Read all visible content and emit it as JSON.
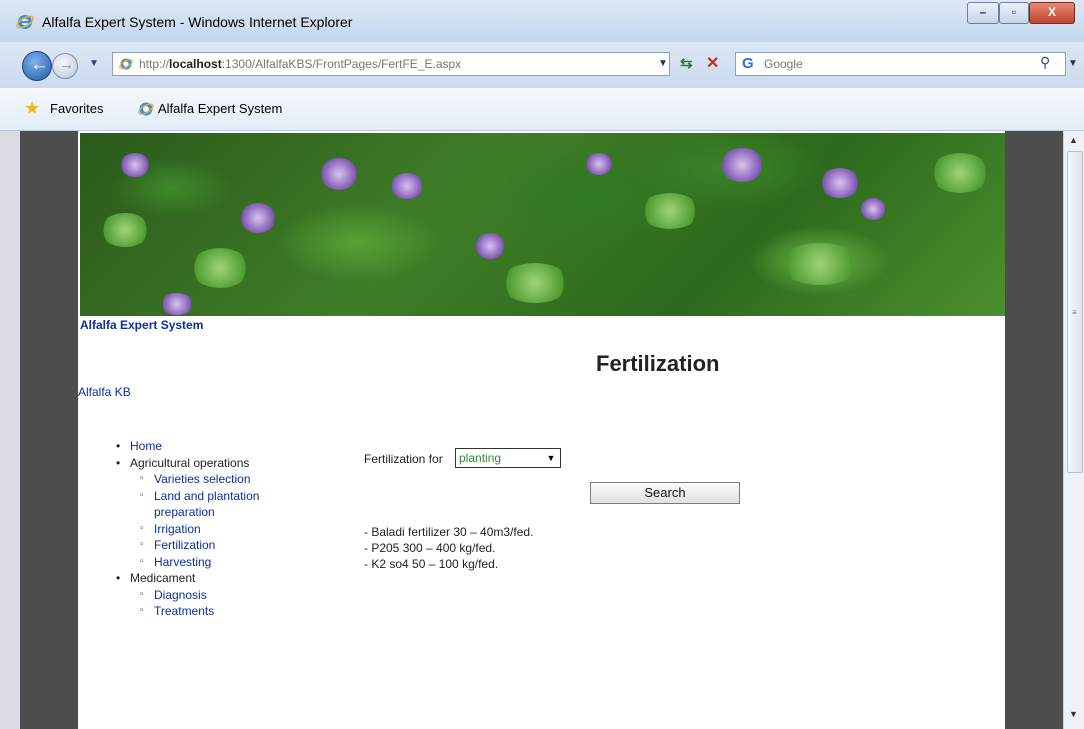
{
  "window": {
    "title": "Alfalfa Expert System - Windows Internet Explorer",
    "minimize_glyph": "–",
    "maximize_glyph": "▫",
    "close_glyph": "X"
  },
  "addressbar": {
    "url_prefix": "http://",
    "url_host": "localhost",
    "url_rest": ":1300/AlfalfaKBS/FrontPages/FertFE_E.aspx",
    "search_placeholder": "Google"
  },
  "favorites_bar": {
    "favorites_label": "Favorites",
    "tab_label": "Alfalfa Expert System"
  },
  "page": {
    "site_title": "Alfalfa Expert System",
    "heading": "Fertilization",
    "kb_link": "Alfalfa KB",
    "menu": {
      "home": "Home",
      "agri_ops": "Agricultural operations",
      "varieties": "Varieties selection",
      "land_prep_line1": "Land and plantation",
      "land_prep_line2": "preparation",
      "irrigation": "Irrigation",
      "fertilization": "Fertilization",
      "harvesting": "Harvesting",
      "medicament": "Medicament",
      "diagnosis": "Diagnosis",
      "treatments": "Treatments"
    },
    "form": {
      "label": "Fertilization for",
      "selected_value": "planting",
      "search_button": "Search"
    },
    "results": [
      "- Baladi fertilizer 30 – 40m3/fed.",
      "- P205 300 – 400 kg/fed.",
      "- K2 so4 50 – 100 kg/fed."
    ]
  },
  "colors": {
    "link_blue": "#0b2f9e",
    "gutter": "#4d4d4d",
    "select_text": "#2f8b2f"
  }
}
